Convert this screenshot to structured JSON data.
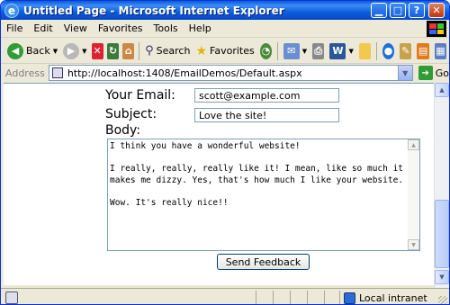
{
  "window": {
    "title": "Untitled Page - Microsoft Internet Explorer"
  },
  "menu": [
    "File",
    "Edit",
    "View",
    "Favorites",
    "Tools",
    "Help"
  ],
  "toolbar": {
    "back_label": "Back",
    "search_label": "Search",
    "favorites_label": "Favorites"
  },
  "address": {
    "label": "Address",
    "url": "http://localhost:1408/EmailDemos/Default.aspx",
    "go_label": "Go"
  },
  "form": {
    "email_label": "Your Email:",
    "email_value": "scott@example.com",
    "subject_label": "Subject:",
    "subject_value": "Love the site!",
    "body_label": "Body:",
    "body_value": "I think you have a wonderful website!\n\nI really, really, really like it! I mean, like so much it makes me dizzy. Yes, that's how much I like your website.\n\nWow. It's really nice!!",
    "send_label": "Send Feedback"
  },
  "status": {
    "zone_label": "Local intranet"
  },
  "icons": {
    "ie_logo": "ie-logo-icon",
    "back": "back-arrow-icon",
    "forward": "forward-arrow-icon",
    "stop": "stop-icon",
    "refresh": "refresh-icon",
    "home": "home-icon",
    "search": "magnifier-icon",
    "favorites": "star-icon",
    "history": "history-icon",
    "mail": "mail-icon",
    "print": "printer-icon",
    "edit": "word-icon",
    "discuss": "folder-icon",
    "messenger": "messenger-icon",
    "go": "go-arrow-icon",
    "zone": "intranet-icon"
  }
}
